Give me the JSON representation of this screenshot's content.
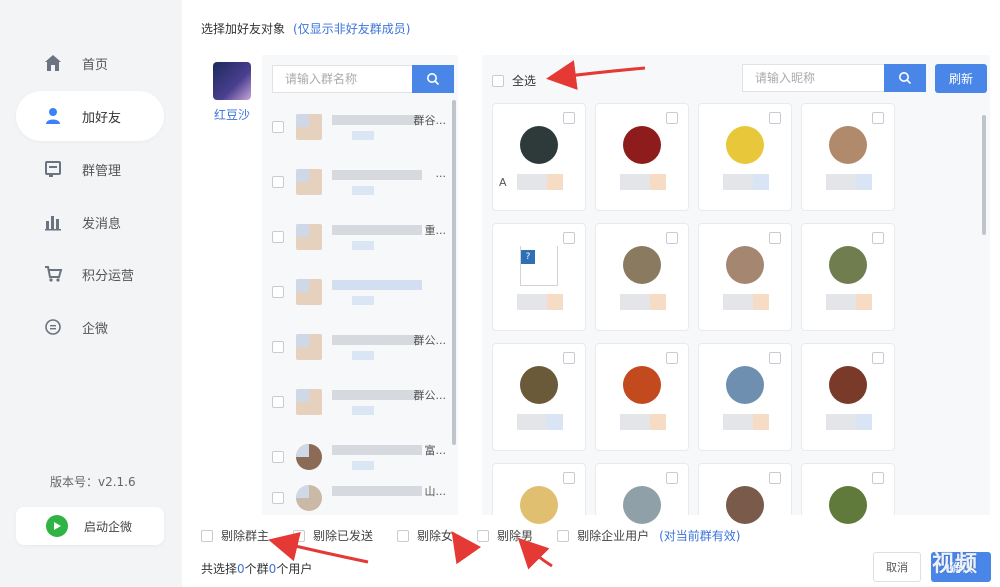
{
  "sidebar": {
    "items": [
      {
        "label": "首页",
        "icon": "home-icon"
      },
      {
        "label": "加好友",
        "icon": "user-icon",
        "active": true
      },
      {
        "label": "群管理",
        "icon": "group-manage-icon"
      },
      {
        "label": "发消息",
        "icon": "bar-chart-icon"
      },
      {
        "label": "积分运营",
        "icon": "cart-icon"
      },
      {
        "label": "企微",
        "icon": "chat-icon"
      }
    ],
    "version": "版本号：v2.1.6",
    "start_button": "启动企微"
  },
  "header": {
    "title": "选择加好友对象",
    "note": "(仅显示非好友群成员)"
  },
  "account": {
    "name": "红豆沙"
  },
  "group_panel": {
    "search_placeholder": "请输入群名称",
    "groups": [
      {
        "suffix": "群谷..."
      },
      {
        "suffix": "..."
      },
      {
        "suffix": "重..."
      },
      {
        "suffix": ""
      },
      {
        "suffix": "群公..."
      },
      {
        "suffix": "群公..."
      },
      {
        "suffix": "富..."
      },
      {
        "suffix": "山..."
      }
    ]
  },
  "friend_panel": {
    "select_all": "全选",
    "search_placeholder": "请输入昵称",
    "refresh": "刷新",
    "first_card_initial": "A"
  },
  "footer": {
    "options": [
      {
        "label": "剔除群主"
      },
      {
        "label": "剔除已发送"
      },
      {
        "label": "剔除女"
      },
      {
        "label": "剔除男"
      },
      {
        "label": "剔除企业用户"
      }
    ],
    "options_note": "(对当前群有效)",
    "summary_prefix": "共选择",
    "summary_groups": "0",
    "summary_mid": "个群",
    "summary_users": "0",
    "summary_suffix": "个用户",
    "cancel": "取消",
    "confirm": "确认",
    "watermark": "视频"
  },
  "colors": {
    "accent": "#4a86e8",
    "link": "#3b74d8",
    "arrow": "#e53935",
    "start_green": "#2fb344"
  }
}
